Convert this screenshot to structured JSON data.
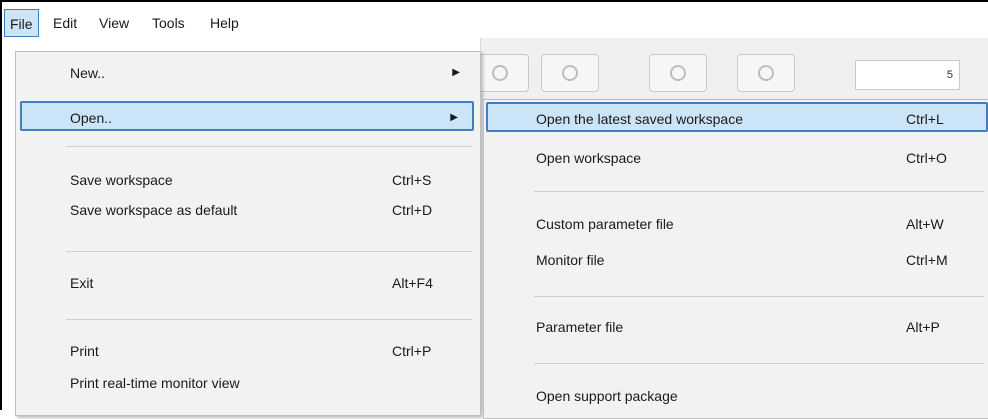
{
  "menubar": {
    "items": [
      "File",
      "Edit",
      "View",
      "Tools",
      "Help"
    ]
  },
  "toolbar": {
    "number_value": "5"
  },
  "file_menu": {
    "items": [
      {
        "label": "New..",
        "accel": "",
        "submenu": true
      },
      {
        "label": "Open..",
        "accel": "",
        "submenu": true
      },
      {
        "label": "Save workspace",
        "accel": "Ctrl+S"
      },
      {
        "label": "Save workspace as default",
        "accel": "Ctrl+D"
      },
      {
        "label": "Exit",
        "accel": "Alt+F4"
      },
      {
        "label": "Print",
        "accel": "Ctrl+P"
      },
      {
        "label": "Print real-time monitor view",
        "accel": ""
      }
    ],
    "submenu_arrow": "▶"
  },
  "open_submenu": {
    "items": [
      {
        "label": "Open the latest saved workspace",
        "accel": "Ctrl+L"
      },
      {
        "label": "Open workspace",
        "accel": "Ctrl+O"
      },
      {
        "label": "Custom parameter file",
        "accel": "Alt+W"
      },
      {
        "label": "Monitor file",
        "accel": "Ctrl+M"
      },
      {
        "label": "Parameter file",
        "accel": "Alt+P"
      },
      {
        "label": "Open support package",
        "accel": ""
      }
    ]
  }
}
